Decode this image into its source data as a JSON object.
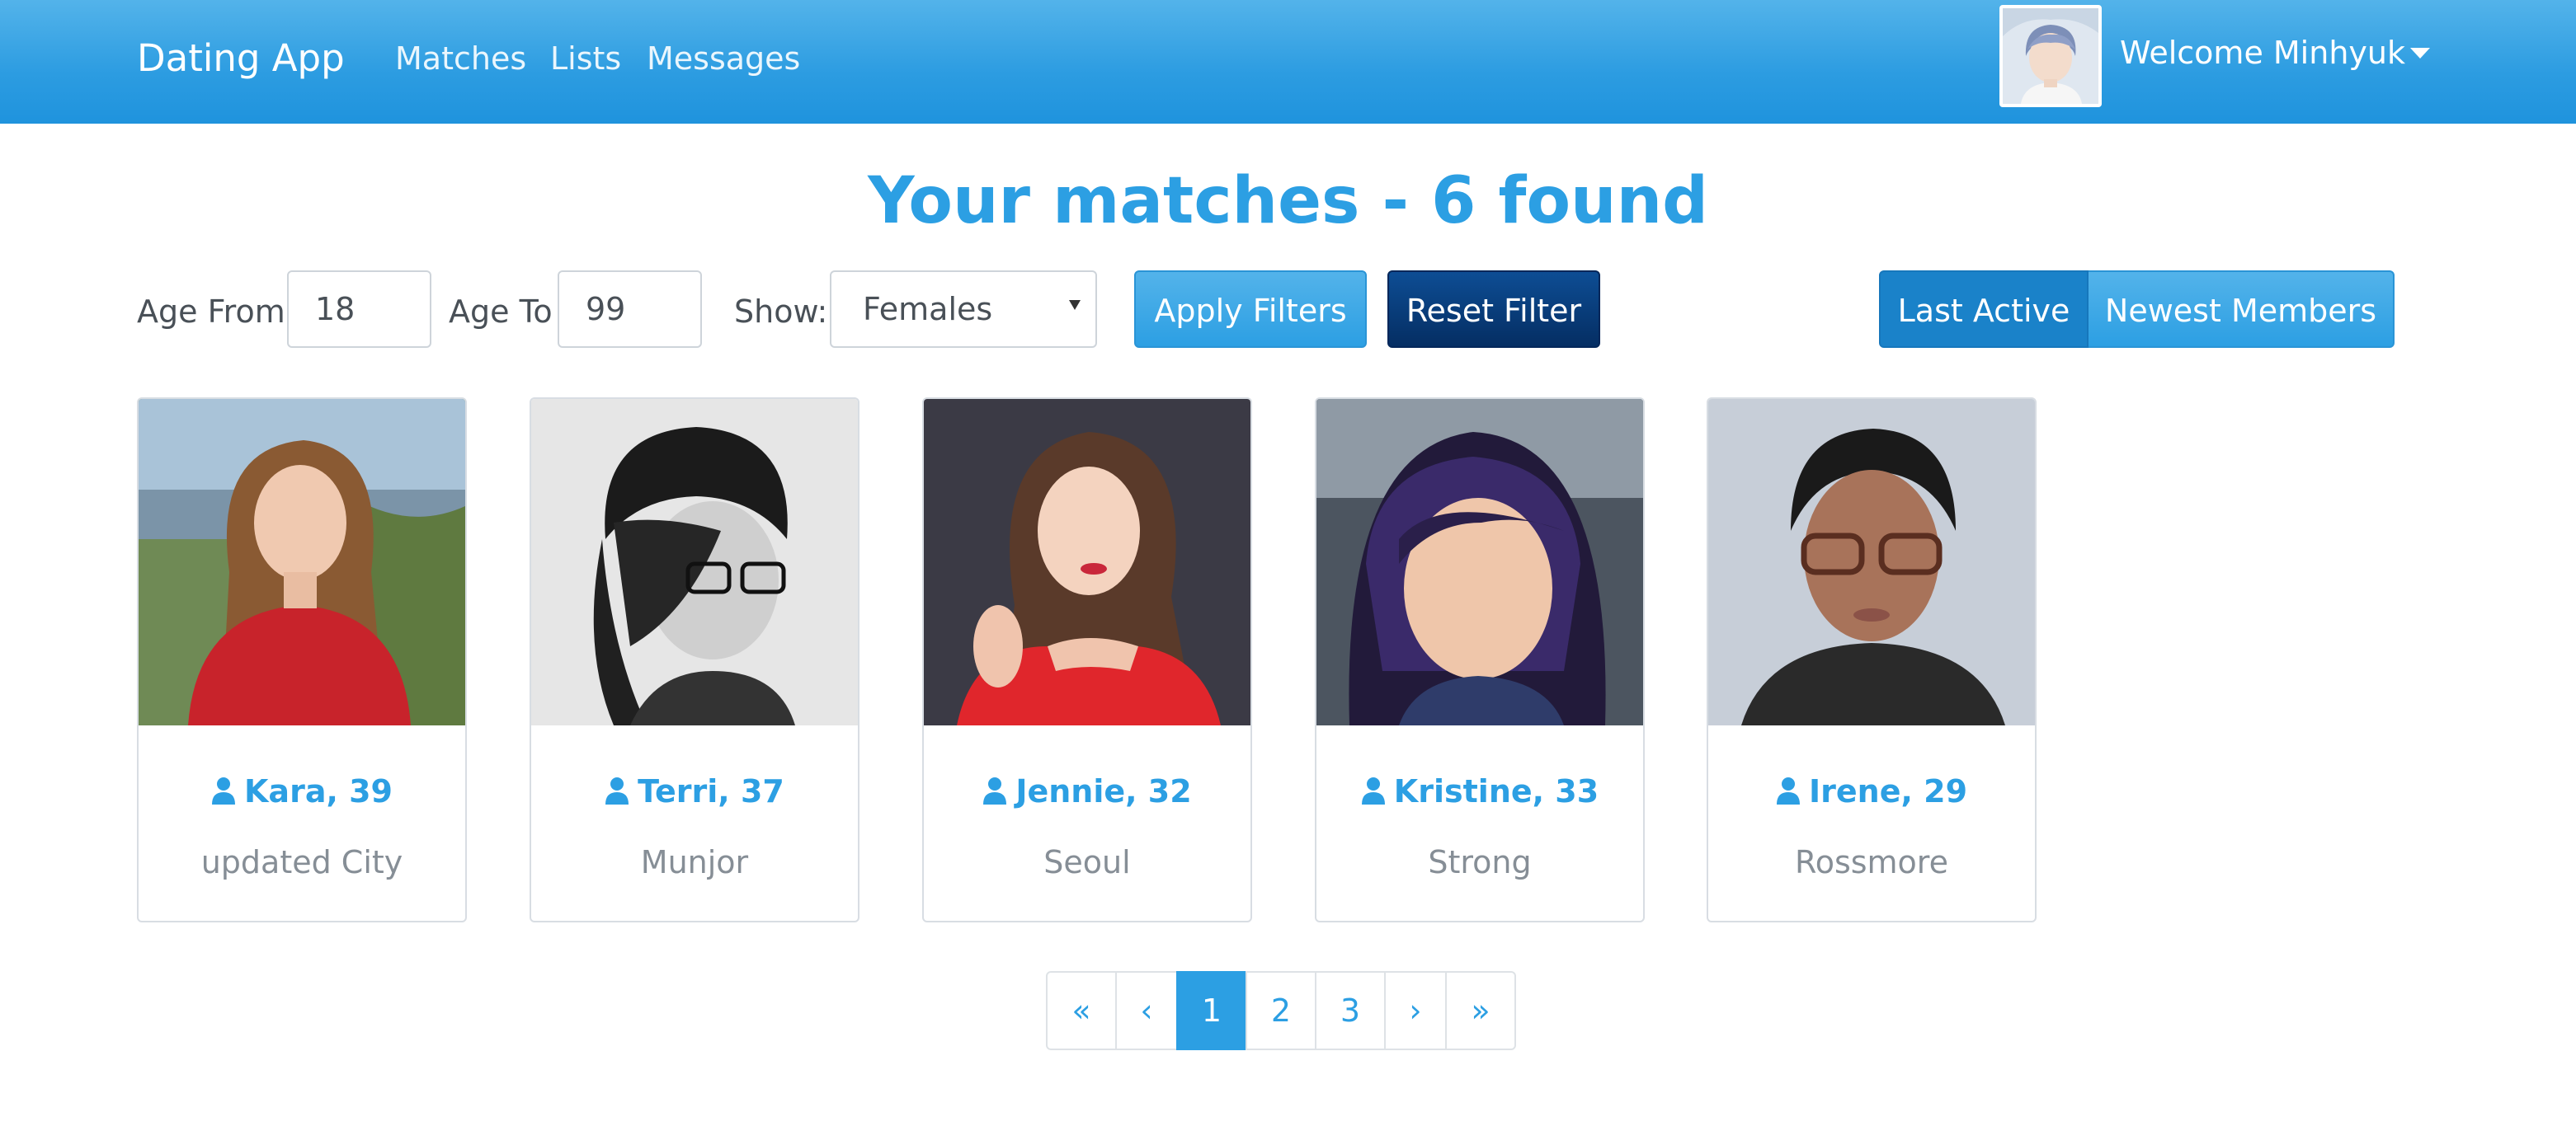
{
  "nav": {
    "brand": "Dating App",
    "links": [
      "Matches",
      "Lists",
      "Messages"
    ],
    "welcome": "Welcome Minhyuk"
  },
  "title": "Your matches - 6 found",
  "filters": {
    "age_from_label": "Age From",
    "age_from_value": "18",
    "age_to_label": "Age To",
    "age_to_value": "99",
    "show_label": "Show:",
    "show_value": "Females",
    "apply_label": "Apply Filters",
    "reset_label": "Reset Filter",
    "sort_last_active": "Last Active",
    "sort_newest": "Newest Members"
  },
  "members": [
    {
      "name": "Kara, 39",
      "city": "updated City"
    },
    {
      "name": "Terri, 37",
      "city": "Munjor"
    },
    {
      "name": "Jennie, 32",
      "city": "Seoul"
    },
    {
      "name": "Kristine, 33",
      "city": "Strong"
    },
    {
      "name": "Irene, 29",
      "city": "Rossmore"
    }
  ],
  "pagination": {
    "first": "«",
    "prev": "‹",
    "pages": [
      "1",
      "2",
      "3"
    ],
    "next": "›",
    "last": "»",
    "current": "1"
  },
  "colors": {
    "primary": "#2c9fe3",
    "nav_dark": "#1a82c9",
    "reset_btn": "#052e63"
  }
}
